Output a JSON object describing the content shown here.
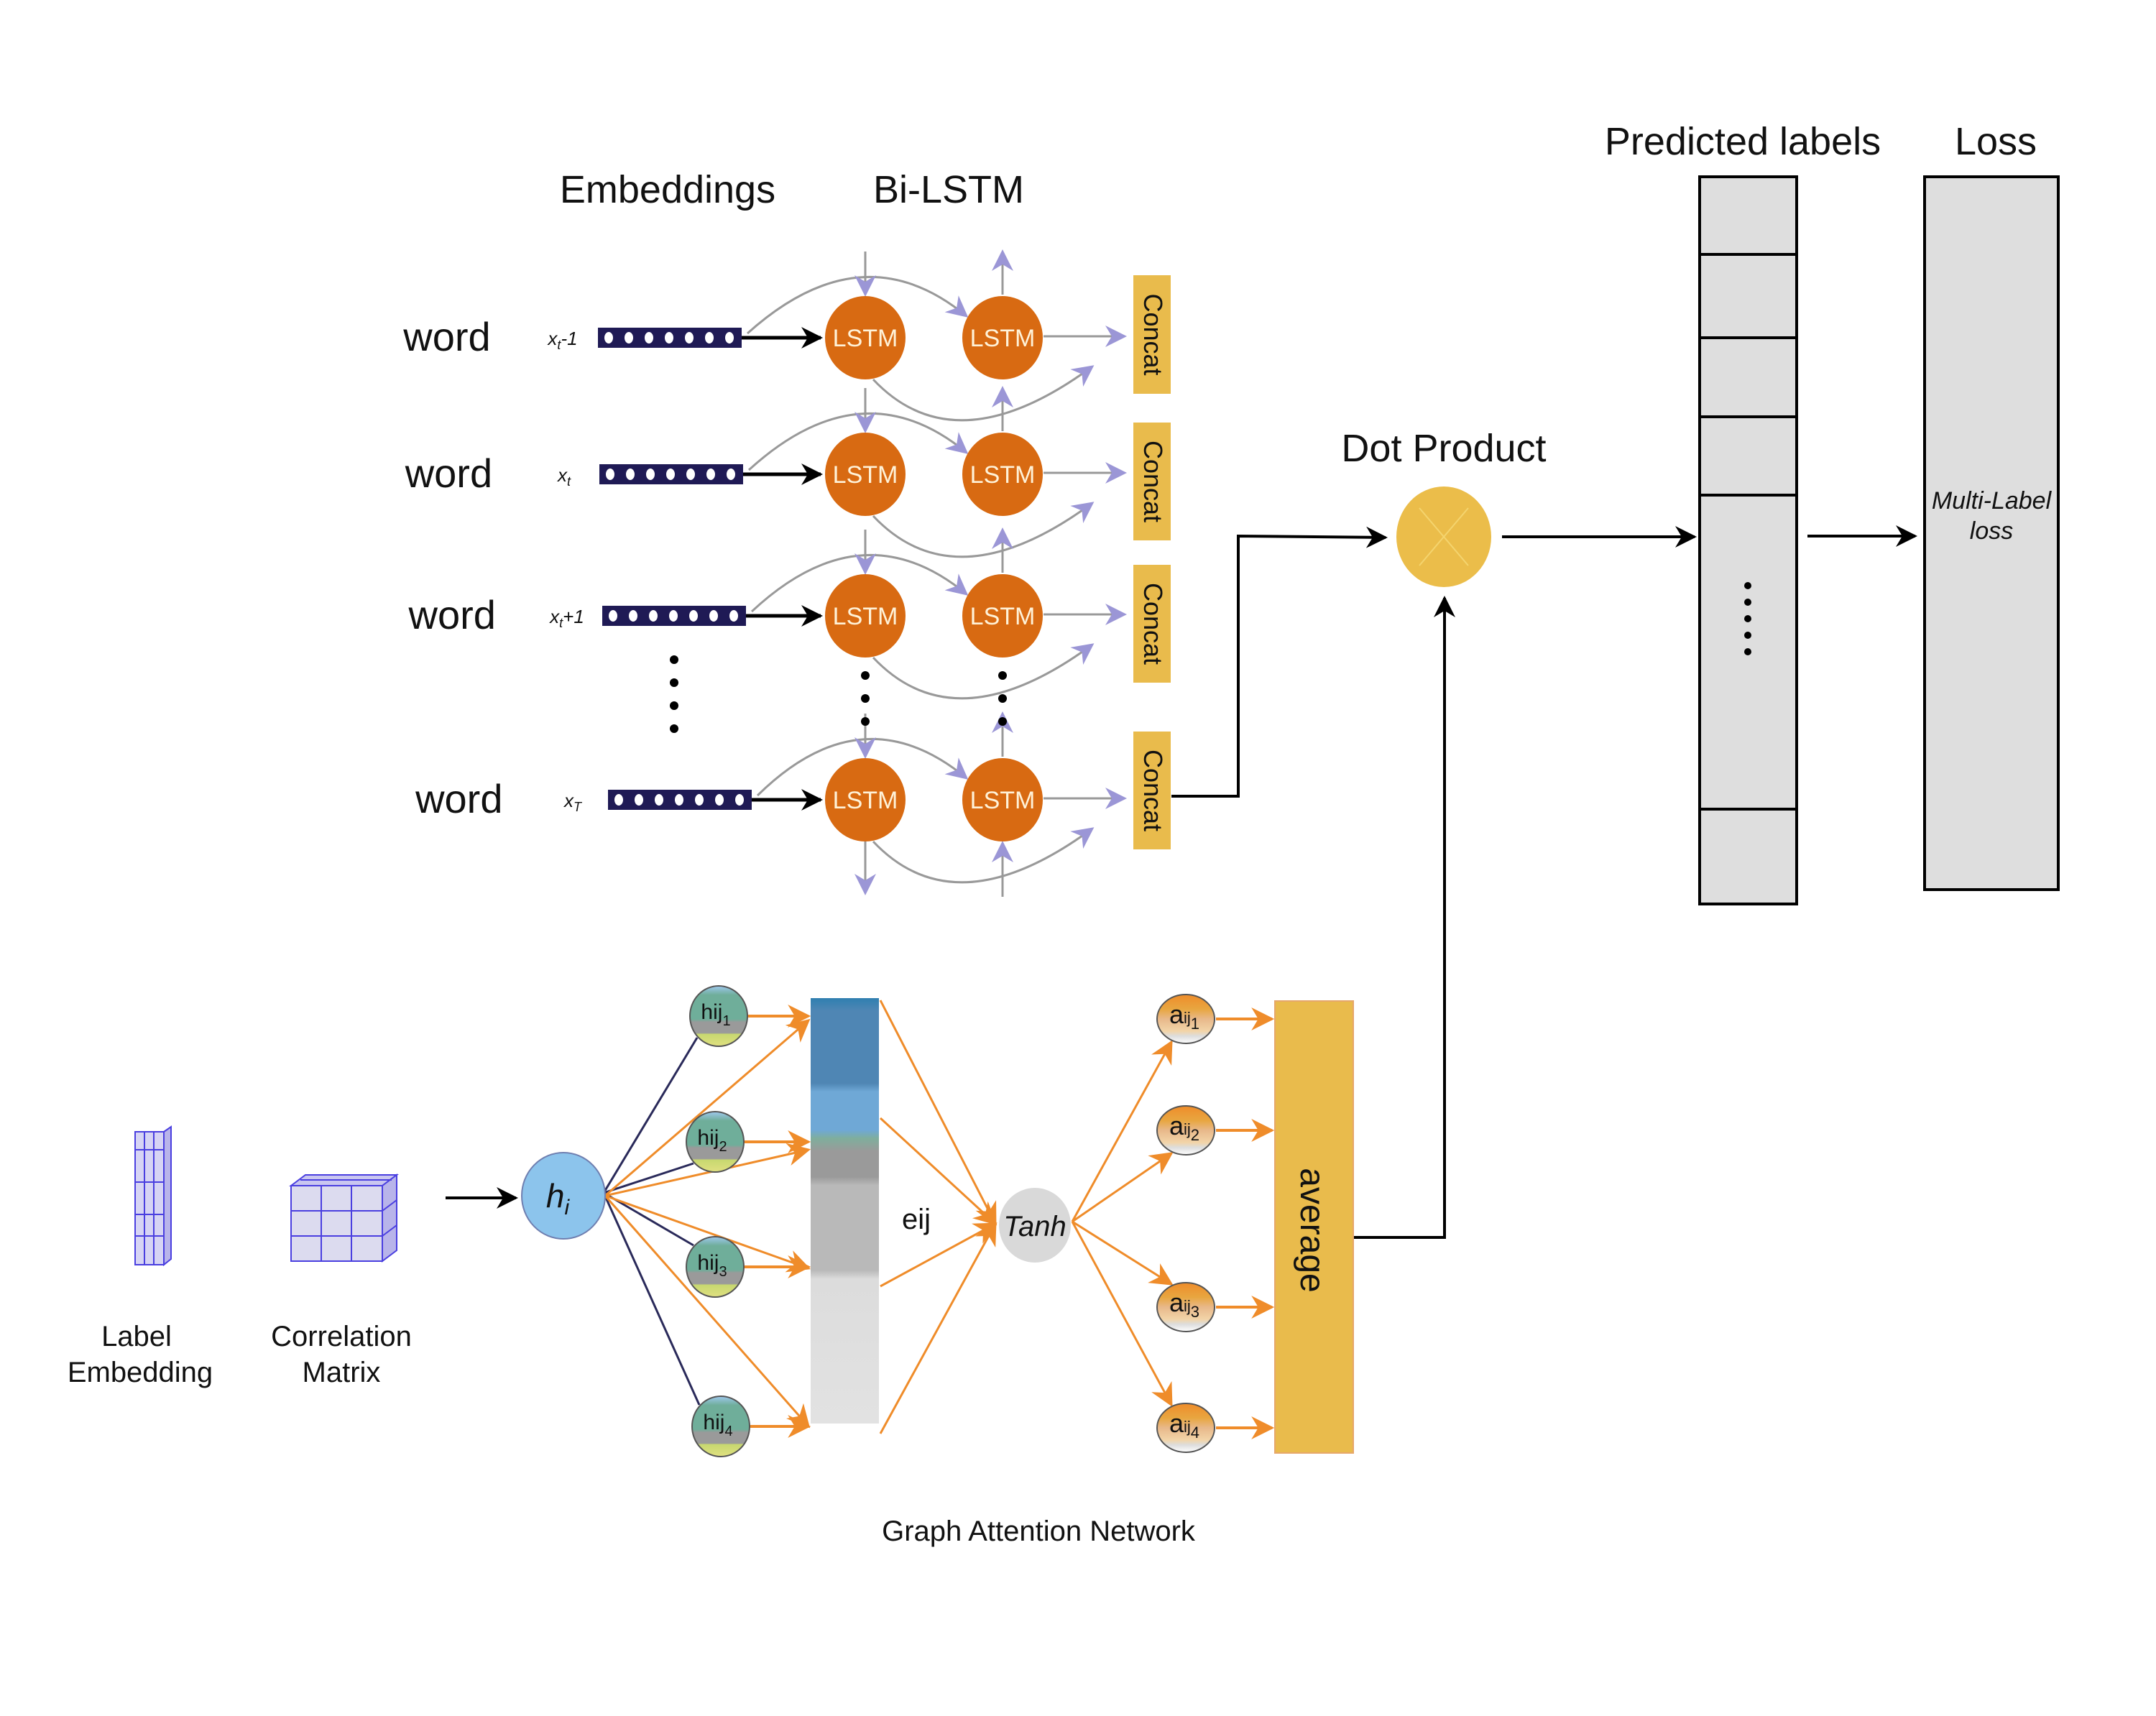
{
  "diagram": {
    "headers": {
      "embeddings": "Embeddings",
      "bilstm": "Bi-LSTM",
      "predicted_labels": "Predicted labels",
      "loss": "Loss",
      "dot_product": "Dot Product"
    },
    "rows": [
      {
        "word": "word",
        "input": "xt-1",
        "input_main": "x",
        "input_sub": "t",
        "input_suffix": "-1"
      },
      {
        "word": "word",
        "input": "xt",
        "input_main": "x",
        "input_sub": "t",
        "input_suffix": ""
      },
      {
        "word": "word",
        "input": "xt+1",
        "input_main": "x",
        "input_sub": "t",
        "input_suffix": "+1"
      },
      {
        "word": "word",
        "input": "xT",
        "input_main": "x",
        "input_sub": "T",
        "input_suffix": ""
      }
    ],
    "lstm_label": "LSTM",
    "concat_label": "Concat",
    "loss_box": {
      "line1": "Multi-Label",
      "line2": "loss"
    },
    "gat": {
      "label_embedding": {
        "line1": "Label",
        "line2": "Embedding"
      },
      "correlation_matrix": {
        "line1": "Correlation",
        "line2": "Matrix"
      },
      "hi": "h",
      "hi_sub": "i",
      "hij_nodes": [
        {
          "main": "hij",
          "sub": "1"
        },
        {
          "main": "hij",
          "sub": "2"
        },
        {
          "main": "hij",
          "sub": "3"
        },
        {
          "main": "hij",
          "sub": "4"
        }
      ],
      "eij": "eij",
      "tanh": "Tanh",
      "aij_nodes": [
        {
          "main": "a",
          "mid": "ij",
          "sub": "1"
        },
        {
          "main": "a",
          "mid": "ij",
          "sub": "2"
        },
        {
          "main": "a",
          "mid": "ij",
          "sub": "3"
        },
        {
          "main": "a",
          "mid": "ij",
          "sub": "4"
        }
      ],
      "average": "average",
      "caption": "Graph Attention Network"
    },
    "colors": {
      "lstm": "#d86a12",
      "concat": "#e9bb4c",
      "embedding_bar": "#1f1a55",
      "arrow_purple": "#9b96d6",
      "gat_orange": "#ef8c2a",
      "hi_node": "#8cc4ec",
      "box_grey": "#dedede",
      "average": "#e9bb4c",
      "dot_product": "#ebbd4a"
    }
  }
}
